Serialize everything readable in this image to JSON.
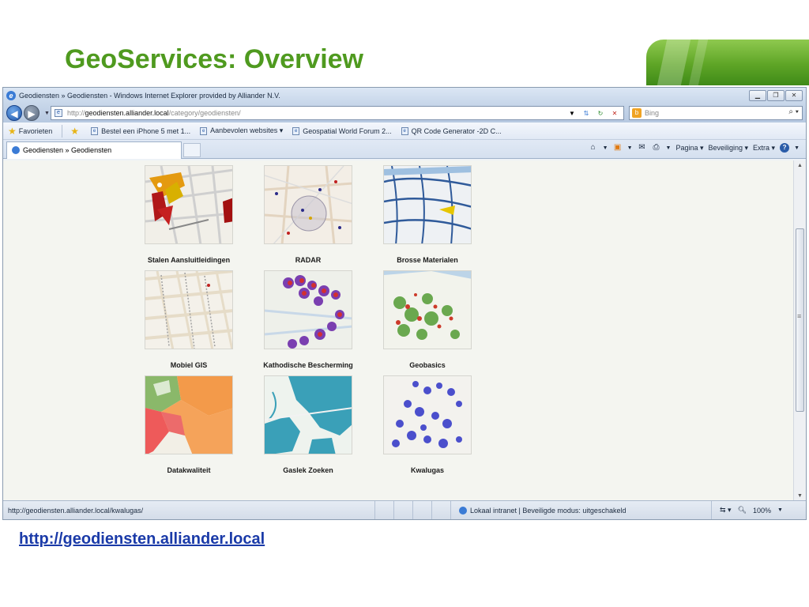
{
  "slide": {
    "title": "GeoServices: Overview",
    "link": "http://geodiensten.alliander.local",
    "accent_color": "#4f9a1f"
  },
  "browser": {
    "window_title": "Geodiensten » Geodiensten - Windows Internet Explorer provided by Alliander N.V.",
    "address": {
      "prefix": "http://",
      "host": "geodiensten.alliander.local",
      "path": "/category/geodiensten/"
    },
    "search_placeholder": "Bing",
    "favorites": {
      "label": "Favorieten",
      "items": [
        "Bestel een iPhone 5 met 1...",
        "Aanbevolen websites ▾",
        "Geospatial World Forum 2...",
        "QR Code Generator -2D C..."
      ]
    },
    "tab_label": "Geodiensten » Geodiensten",
    "commands": {
      "page": "Pagina ▾",
      "security": "Beveiliging ▾",
      "extra": "Extra ▾"
    },
    "status": {
      "url": "http://geodiensten.alliander.local/kwalugas/",
      "zone": "Lokaal intranet | Beveiligde modus: uitgeschakeld",
      "zoom": "100%"
    }
  },
  "tiles": [
    {
      "label": "Stalen Aansluitleidingen",
      "icon": "map-thumbnail-red-orange"
    },
    {
      "label": "RADAR",
      "icon": "map-thumbnail-radar-circle"
    },
    {
      "label": "Brosse Materialen",
      "icon": "map-thumbnail-blue-canals"
    },
    {
      "label": "Mobiel GIS",
      "icon": "map-thumbnail-street-grid"
    },
    {
      "label": "Kathodische Bescherming",
      "icon": "map-thumbnail-purple-dots"
    },
    {
      "label": "Geobasics",
      "icon": "map-thumbnail-green-red"
    },
    {
      "label": "Datakwaliteit",
      "icon": "map-thumbnail-region-colors"
    },
    {
      "label": "Gaslek Zoeken",
      "icon": "map-thumbnail-teal-network"
    },
    {
      "label": "Kwalugas",
      "icon": "map-thumbnail-blue-dots"
    }
  ]
}
